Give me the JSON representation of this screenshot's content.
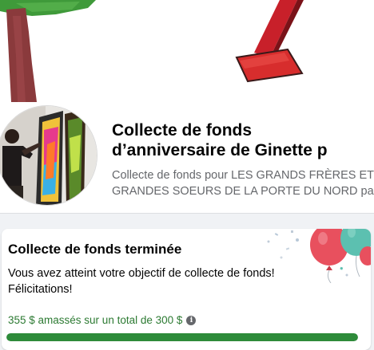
{
  "colors": {
    "accent_green": "#2e8b3a",
    "progress_text": "#2c7a32",
    "muted_text": "#65676b"
  },
  "cover": {
    "description_icon": "child-drawing-cover-icon"
  },
  "header": {
    "title_line1": "Collecte de fonds",
    "title_line2": "d’anniversaire de Ginette p",
    "subtitle_line1": "Collecte de fonds pour LES GRANDS FRÈRES ET",
    "subtitle_line2": "GRANDES SOEURS DE LA PORTE DU NORD par"
  },
  "card": {
    "title": "Collecte de fonds terminée",
    "message_line1": "Vous avez atteint votre objectif de collecte de fonds!",
    "message_line2": "Félicitations!",
    "progress_text": "355 $ amassés sur un total de 300 $",
    "info_icon_glyph": "i",
    "progress_fraction": 1.0
  }
}
